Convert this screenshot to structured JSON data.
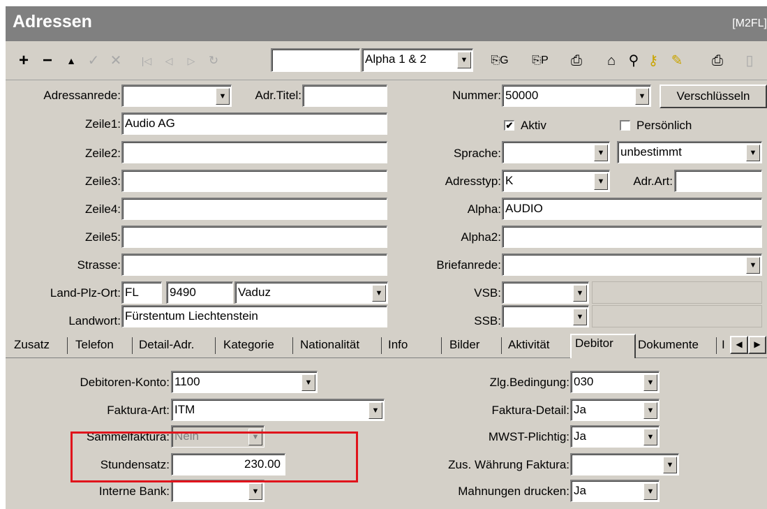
{
  "window": {
    "title": "Adressen",
    "code": "[M2FL]"
  },
  "toolbar": {
    "search_value": "",
    "view_select": "Alpha 1 & 2",
    "btn_g": "G",
    "btn_p": "P"
  },
  "form": {
    "adressanrede_label": "Adressanrede:",
    "adressanrede_value": "",
    "adr_titel_label": "Adr.Titel:",
    "adr_titel_value": "",
    "zeile1_label": "Zeile1:",
    "zeile1_value": "Audio AG",
    "zeile2_label": "Zeile2:",
    "zeile2_value": "",
    "zeile3_label": "Zeile3:",
    "zeile3_value": "",
    "zeile4_label": "Zeile4:",
    "zeile4_value": "",
    "zeile5_label": "Zeile5:",
    "zeile5_value": "",
    "strasse_label": "Strasse:",
    "strasse_value": "",
    "land_plz_ort_label": "Land-Plz-Ort:",
    "land_value": "FL",
    "plz_value": "9490",
    "ort_value": "Vaduz",
    "landwort_label": "Landwort:",
    "landwort_value": "Fürstentum Liechtenstein",
    "nummer_label": "Nummer:",
    "nummer_value": "50000",
    "verschluesseln_label": "Verschlüsseln",
    "aktiv_label": "Aktiv",
    "aktiv_checked": "✔",
    "persoenlich_label": "Persönlich",
    "sprache_label": "Sprache:",
    "sprache_value": "",
    "sprache2_value": "unbestimmt",
    "adresstyp_label": "Adresstyp:",
    "adresstyp_value": "K",
    "adr_art_label": "Adr.Art:",
    "adr_art_value": "",
    "alpha_label": "Alpha:",
    "alpha_value": "AUDIO",
    "alpha2_label": "Alpha2:",
    "alpha2_value": "",
    "briefanrede_label": "Briefanrede:",
    "briefanrede_value": "",
    "vsb_label": "VSB:",
    "vsb_value": "",
    "ssb_label": "SSB:",
    "ssb_value": ""
  },
  "tabs": [
    "Zusatz",
    "Telefon",
    "Detail-Adr.",
    "Kategorie",
    "Nationalität",
    "Info",
    "Bilder",
    "Aktivität",
    "Debitor",
    "Dokumente",
    "I"
  ],
  "debitor": {
    "konto_label": "Debitoren-Konto:",
    "konto_value": "1100",
    "faktura_art_label": "Faktura-Art:",
    "faktura_art_value": "ITM",
    "sammelfaktura_label": "Sammelfaktura:",
    "sammelfaktura_value": "Nein",
    "stundensatz_label": "Stundensatz:",
    "stundensatz_value": "230.00",
    "interne_bank_label": "Interne Bank:",
    "interne_bank_value": "",
    "zlg_label": "Zlg.Bedingung:",
    "zlg_value": "030",
    "faktura_detail_label": "Faktura-Detail:",
    "faktura_detail_value": "Ja",
    "mwst_label": "MWST-Plichtig:",
    "mwst_value": "Ja",
    "zus_waehrung_label": "Zus. Währung Faktura:",
    "zus_waehrung_value": "",
    "mahnungen_label": "Mahnungen drucken:",
    "mahnungen_value": "Ja"
  },
  "colors": {
    "highlight": "#e0141c",
    "window_bg": "#d4d0c8",
    "title_bg": "#808080"
  }
}
